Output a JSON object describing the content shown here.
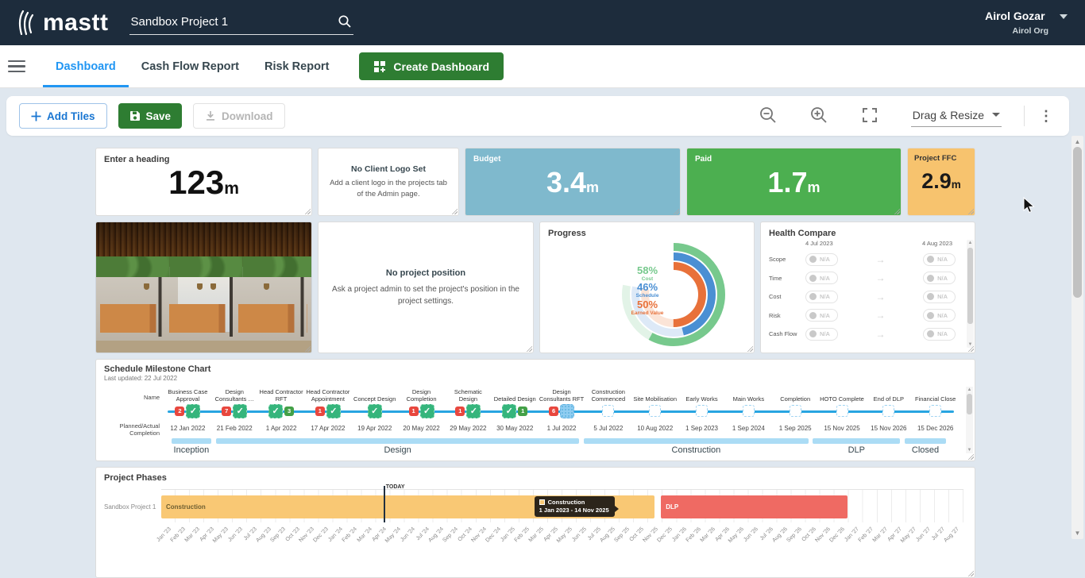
{
  "header": {
    "logo_text": "mastt",
    "search_value": "Sandbox Project 1",
    "user_name": "Airol Gozar",
    "org_name": "Airol Org"
  },
  "nav": {
    "tabs": [
      "Dashboard",
      "Cash Flow Report",
      "Risk Report"
    ],
    "active_tab": "Dashboard",
    "create_button_label": "Create Dashboard"
  },
  "toolbar": {
    "add_tiles_label": "Add Tiles",
    "save_label": "Save",
    "download_label": "Download",
    "mode_label": "Drag & Resize"
  },
  "tiles": {
    "heading_stat": {
      "title": "Enter a heading",
      "value": "123",
      "unit": "m"
    },
    "client_logo": {
      "title": "No Client Logo Set",
      "message": "Add a client logo in the projects tab of the Admin page."
    },
    "budget": {
      "title": "Budget",
      "value": "3.4",
      "unit": "m",
      "color": "#7fb9cd"
    },
    "paid": {
      "title": "Paid",
      "value": "1.7",
      "unit": "m",
      "color": "#4caf50"
    },
    "ffc": {
      "title": "Project FFC",
      "value": "2.9",
      "unit": "m",
      "color": "#f7c36e"
    },
    "position": {
      "title": "No project position",
      "message": "Ask a project admin to set the project's position in the project settings."
    },
    "progress": {
      "title": "Progress",
      "metrics": [
        {
          "label": "Cost",
          "value": 58,
          "color": "#77c98d",
          "track": "#e2f3e7"
        },
        {
          "label": "Schedule",
          "value": 46,
          "color": "#4a8fd3",
          "track": "#dde9f7"
        },
        {
          "label": "Earned Value",
          "value": 50,
          "color": "#e8713a",
          "track": "#fbe4d7"
        }
      ]
    },
    "health": {
      "title": "Health Compare",
      "date_from": "4 Jul 2023",
      "date_to": "4 Aug 2023",
      "badge_text": "N/A",
      "rows": [
        "Scope",
        "Time",
        "Cost",
        "Risk",
        "Cash Flow"
      ]
    }
  },
  "milestone_chart": {
    "title": "Schedule Milestone Chart",
    "last_updated": "Last updated: 22 Jul 2022",
    "row_label_name": "Name",
    "row_label_completion": "Planned/Actual Completion",
    "milestones": [
      {
        "name": "Business Case Approval",
        "date": "12 Jan 2022",
        "pre_badge": "2",
        "post_badge": null,
        "state": "done"
      },
      {
        "name": "Design Consultants …",
        "date": "21 Feb 2022",
        "pre_badge": "7",
        "post_badge": null,
        "state": "done"
      },
      {
        "name": "Head Contractor RFT",
        "date": "1 Apr 2022",
        "pre_badge": null,
        "post_badge": "3",
        "state": "done"
      },
      {
        "name": "Head Contractor Appointment",
        "date": "17 Apr 2022",
        "pre_badge": "1",
        "post_badge": null,
        "state": "done"
      },
      {
        "name": "Concept Design",
        "date": "19 Apr 2022",
        "pre_badge": null,
        "post_badge": null,
        "state": "done"
      },
      {
        "name": "Design Completion",
        "date": "20 May 2022",
        "pre_badge": "1",
        "post_badge": null,
        "state": "done"
      },
      {
        "name": "Schematic Design",
        "date": "29 May 2022",
        "pre_badge": "1",
        "post_badge": null,
        "state": "done"
      },
      {
        "name": "Detailed Design",
        "date": "30 May 2022",
        "pre_badge": null,
        "post_badge": "1",
        "state": "done"
      },
      {
        "name": "Design Consultants RFT",
        "date": "1 Jul 2022",
        "pre_badge": "6",
        "post_badge": null,
        "state": "current"
      },
      {
        "name": "Construction Commenced",
        "date": "5 Jul 2022",
        "pre_badge": null,
        "post_badge": null,
        "state": "future"
      },
      {
        "name": "Site Mobilisation",
        "date": "10 Aug 2022",
        "pre_badge": null,
        "post_badge": null,
        "state": "future"
      },
      {
        "name": "Early Works",
        "date": "1 Sep 2023",
        "pre_badge": null,
        "post_badge": null,
        "state": "future"
      },
      {
        "name": "Main Works",
        "date": "1 Sep 2024",
        "pre_badge": null,
        "post_badge": null,
        "state": "future"
      },
      {
        "name": "Completion",
        "date": "1 Sep 2025",
        "pre_badge": null,
        "post_badge": null,
        "state": "future"
      },
      {
        "name": "HOTO Complete",
        "date": "15 Nov 2025",
        "pre_badge": null,
        "post_badge": null,
        "state": "future"
      },
      {
        "name": "End of DLP",
        "date": "15 Nov 2026",
        "pre_badge": null,
        "post_badge": null,
        "state": "future"
      },
      {
        "name": "Financial Close",
        "date": "15 Dec 2026",
        "pre_badge": null,
        "post_badge": null,
        "state": "future"
      }
    ],
    "phases": [
      {
        "label": "Inception",
        "start_pct": 0.5,
        "end_pct": 5.6
      },
      {
        "label": "Design",
        "start_pct": 6.2,
        "end_pct": 52.9
      },
      {
        "label": "Construction",
        "start_pct": 53.5,
        "end_pct": 82.3
      },
      {
        "label": "DLP",
        "start_pct": 82.9,
        "end_pct": 94.1
      },
      {
        "label": "Closed",
        "start_pct": 94.7,
        "end_pct": 100
      }
    ]
  },
  "gantt": {
    "title": "Project Phases",
    "row_label": "Sandbox Project 1",
    "today_label": "TODAY",
    "today_pct": 27.7,
    "bars": [
      {
        "label": "Construction",
        "left_pct": 0,
        "width_pct": 61.5,
        "color": "#f9c874",
        "text_color": "#6d5e31"
      },
      {
        "label": "DLP",
        "left_pct": 62.3,
        "width_pct": 23.2,
        "color": "#ef6a63",
        "text_color": "#ffffff"
      }
    ],
    "tooltip": {
      "title": "Construction",
      "range": "1 Jan 2023 - 14 Nov 2025",
      "left_pct": 46.5
    },
    "months": [
      "Jan '23",
      "Feb '23",
      "Mar '23",
      "Apr '23",
      "May '23",
      "Jun '23",
      "Jul '23",
      "Aug '23",
      "Sep '23",
      "Oct '23",
      "Nov '23",
      "Dec '23",
      "Jan '24",
      "Feb '24",
      "Mar '24",
      "Apr '24",
      "May '24",
      "Jun '24",
      "Jul '24",
      "Aug '24",
      "Sep '24",
      "Oct '24",
      "Nov '24",
      "Dec '24",
      "Jan '25",
      "Feb '25",
      "Mar '25",
      "Apr '25",
      "May '25",
      "Jun '25",
      "Jul '25",
      "Aug '25",
      "Sep '25",
      "Oct '25",
      "Nov '25",
      "Dec '25",
      "Jan '26",
      "Feb '26",
      "Mar '26",
      "Apr '26",
      "May '26",
      "Jun '26",
      "Jul '26",
      "Aug '26",
      "Sep '26",
      "Oct '26",
      "Nov '26",
      "Dec '26",
      "Jan '27",
      "Feb '27",
      "Mar '27",
      "Apr '27",
      "May '27",
      "Jun '27",
      "Jul '27",
      "Aug '27"
    ]
  }
}
